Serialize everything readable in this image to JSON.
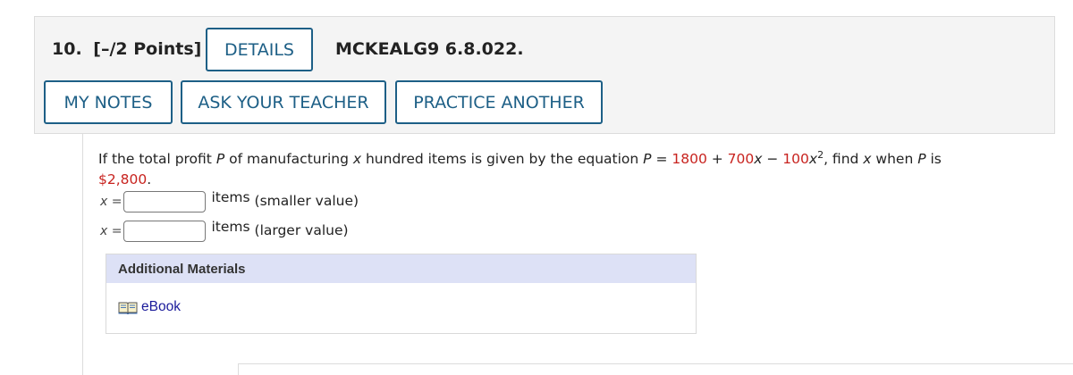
{
  "question": {
    "number": "10.",
    "points": "[–/2 Points]",
    "code": "MCKEALG9 6.8.022."
  },
  "buttons": {
    "details": "DETAILS",
    "my_notes": "MY NOTES",
    "ask_teacher": "ASK YOUR TEACHER",
    "practice_another": "PRACTICE ANOTHER"
  },
  "problem": {
    "text_1": "If the total profit ",
    "var_p": "P",
    "text_2": " of manufacturing ",
    "var_x": "x",
    "text_3": " hundred items is given by the equation  ",
    "eq_p": "P",
    "eq_eq": " = ",
    "eq_c1": "1800",
    "eq_plus": " + ",
    "eq_c2": "700",
    "eq_x1": "x",
    "eq_minus": " − ",
    "eq_c3": "100",
    "eq_x2": "x",
    "eq_exp": "2",
    "text_4": ",  find ",
    "var_x2": "x",
    "text_5": " when ",
    "var_p2": "P",
    "text_6": " is",
    "amount": "$2,800",
    "period": "."
  },
  "answers": [
    {
      "var": "x =",
      "value": "",
      "suffix": "items",
      "note": "(smaller value)"
    },
    {
      "var": "x =",
      "value": "",
      "suffix": "items",
      "note": "(larger value)"
    }
  ],
  "materials": {
    "header": "Additional Materials",
    "ebook_label": "eBook",
    "icon": "book-icon"
  },
  "colors": {
    "button_border": "#1d5f86",
    "red_value": "#c8231f",
    "materials_header_bg": "#dde1f6",
    "link": "#1a1a9a"
  }
}
